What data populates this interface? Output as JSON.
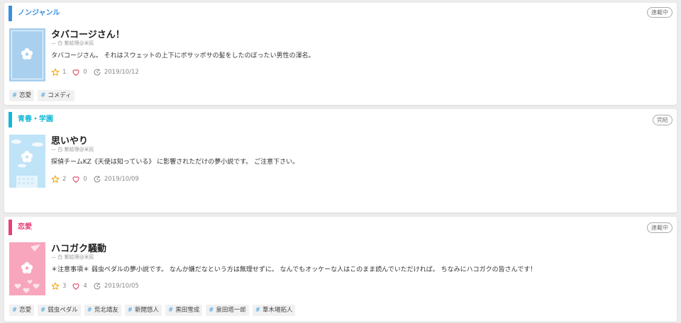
{
  "works": [
    {
      "genre": "ノンジャンル",
      "genre_color": "#3a8ee0",
      "status": "連載中",
      "cover_color": "#a9d0ef",
      "title": "タバコージさん！",
      "author": "— 白 紫絵理@米民",
      "description": "タバコージさん。 それはスウェットの上下にボサッボサの髪をしたのぼったい男性の渾名。",
      "stars": "1",
      "hearts": "0",
      "date": "2019/10/12",
      "tags": [
        "恋愛",
        "コメディ"
      ]
    },
    {
      "genre": "青春・学園",
      "genre_color": "#10b8d8",
      "status": "完結",
      "cover_color": "#bfe3f7",
      "title": "思いやり",
      "author": "— 白 紫絵理@米民",
      "description": "探偵チームKZ《天使は知っている》 に影響されただけの夢小説です。 ご注意下さい。",
      "stars": "2",
      "hearts": "0",
      "date": "2019/10/09",
      "tags": []
    },
    {
      "genre": "恋愛",
      "genre_color": "#e83e7a",
      "status": "連載中",
      "cover_color": "#f7a6bd",
      "title": "ハコガク騒動",
      "author": "— 白 紫絵理@米民",
      "description": "＊注意事項＊ 弱虫ペダルの夢小説です。 なんか嫌だなという方は無理せずに。 なんでもオッケーな人はこのまま読んでいただければ。 ちなみにハコガクの皆さんです！",
      "stars": "3",
      "hearts": "4",
      "date": "2019/10/05",
      "tags": [
        "恋愛",
        "弱虫ペダル",
        "荒北靖友",
        "新開悠人",
        "黒田雪成",
        "泉田塔一郎",
        "葦木場拓人"
      ]
    }
  ]
}
